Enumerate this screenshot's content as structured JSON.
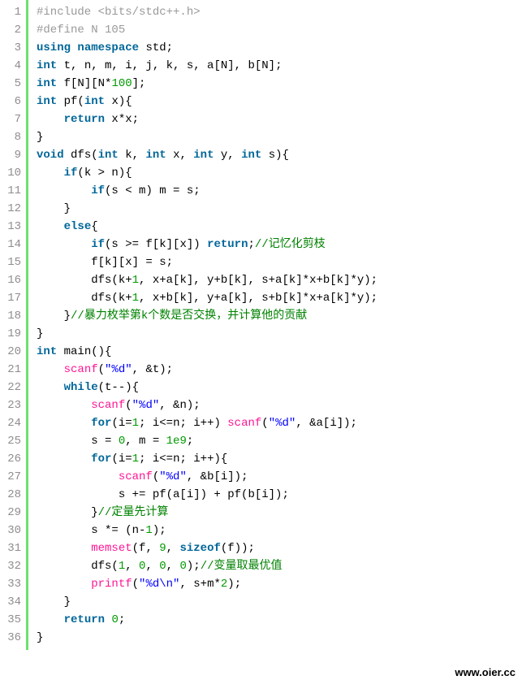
{
  "watermark": "www.oier.cc",
  "lines": [
    [
      {
        "cls": "c-pre",
        "t": "#include <bits/stdc++.h>"
      }
    ],
    [
      {
        "cls": "c-pre",
        "t": "#define N 105"
      }
    ],
    [
      {
        "cls": "c-kw",
        "t": "using"
      },
      {
        "cls": "c-plain",
        "t": " "
      },
      {
        "cls": "c-kw",
        "t": "namespace"
      },
      {
        "cls": "c-plain",
        "t": " std;"
      }
    ],
    [
      {
        "cls": "c-type",
        "t": "int"
      },
      {
        "cls": "c-plain",
        "t": " t, n, m, i, j, k, s, a[N], b[N];"
      }
    ],
    [
      {
        "cls": "c-type",
        "t": "int"
      },
      {
        "cls": "c-plain",
        "t": " f[N][N*"
      },
      {
        "cls": "c-num",
        "t": "100"
      },
      {
        "cls": "c-plain",
        "t": "];"
      }
    ],
    [
      {
        "cls": "c-type",
        "t": "int"
      },
      {
        "cls": "c-plain",
        "t": " pf("
      },
      {
        "cls": "c-type",
        "t": "int"
      },
      {
        "cls": "c-plain",
        "t": " x){"
      }
    ],
    [
      {
        "cls": "c-plain",
        "t": "    "
      },
      {
        "cls": "c-kw",
        "t": "return"
      },
      {
        "cls": "c-plain",
        "t": " x*x;"
      }
    ],
    [
      {
        "cls": "c-plain",
        "t": "}"
      }
    ],
    [
      {
        "cls": "c-type",
        "t": "void"
      },
      {
        "cls": "c-plain",
        "t": " dfs("
      },
      {
        "cls": "c-type",
        "t": "int"
      },
      {
        "cls": "c-plain",
        "t": " k, "
      },
      {
        "cls": "c-type",
        "t": "int"
      },
      {
        "cls": "c-plain",
        "t": " x, "
      },
      {
        "cls": "c-type",
        "t": "int"
      },
      {
        "cls": "c-plain",
        "t": " y, "
      },
      {
        "cls": "c-type",
        "t": "int"
      },
      {
        "cls": "c-plain",
        "t": " s){"
      }
    ],
    [
      {
        "cls": "c-plain",
        "t": "    "
      },
      {
        "cls": "c-kw",
        "t": "if"
      },
      {
        "cls": "c-plain",
        "t": "(k > n){"
      }
    ],
    [
      {
        "cls": "c-plain",
        "t": "        "
      },
      {
        "cls": "c-kw",
        "t": "if"
      },
      {
        "cls": "c-plain",
        "t": "(s < m) m = s;"
      }
    ],
    [
      {
        "cls": "c-plain",
        "t": "    }"
      }
    ],
    [
      {
        "cls": "c-plain",
        "t": "    "
      },
      {
        "cls": "c-kw",
        "t": "else"
      },
      {
        "cls": "c-plain",
        "t": "{"
      }
    ],
    [
      {
        "cls": "c-plain",
        "t": "        "
      },
      {
        "cls": "c-kw",
        "t": "if"
      },
      {
        "cls": "c-plain",
        "t": "(s >= f[k][x]) "
      },
      {
        "cls": "c-kw",
        "t": "return"
      },
      {
        "cls": "c-plain",
        "t": ";"
      },
      {
        "cls": "c-cmt",
        "t": "//记忆化剪枝"
      }
    ],
    [
      {
        "cls": "c-plain",
        "t": "        f[k][x] = s;"
      }
    ],
    [
      {
        "cls": "c-plain",
        "t": "        dfs(k+"
      },
      {
        "cls": "c-num",
        "t": "1"
      },
      {
        "cls": "c-plain",
        "t": ", x+a[k], y+b[k], s+a[k]*x+b[k]*y);"
      }
    ],
    [
      {
        "cls": "c-plain",
        "t": "        dfs(k+"
      },
      {
        "cls": "c-num",
        "t": "1"
      },
      {
        "cls": "c-plain",
        "t": ", x+b[k], y+a[k], s+b[k]*x+a[k]*y);"
      }
    ],
    [
      {
        "cls": "c-plain",
        "t": "    }"
      },
      {
        "cls": "c-cmt",
        "t": "//暴力枚举第k个数是否交换，并计算他的贡献"
      }
    ],
    [
      {
        "cls": "c-plain",
        "t": "}"
      }
    ],
    [
      {
        "cls": "c-type",
        "t": "int"
      },
      {
        "cls": "c-plain",
        "t": " main(){"
      }
    ],
    [
      {
        "cls": "c-plain",
        "t": "    "
      },
      {
        "cls": "c-func",
        "t": "scanf"
      },
      {
        "cls": "c-plain",
        "t": "("
      },
      {
        "cls": "c-str",
        "t": "\"%d\""
      },
      {
        "cls": "c-plain",
        "t": ", &t);"
      }
    ],
    [
      {
        "cls": "c-plain",
        "t": "    "
      },
      {
        "cls": "c-kw",
        "t": "while"
      },
      {
        "cls": "c-plain",
        "t": "(t--){"
      }
    ],
    [
      {
        "cls": "c-plain",
        "t": "        "
      },
      {
        "cls": "c-func",
        "t": "scanf"
      },
      {
        "cls": "c-plain",
        "t": "("
      },
      {
        "cls": "c-str",
        "t": "\"%d\""
      },
      {
        "cls": "c-plain",
        "t": ", &n);"
      }
    ],
    [
      {
        "cls": "c-plain",
        "t": "        "
      },
      {
        "cls": "c-kw",
        "t": "for"
      },
      {
        "cls": "c-plain",
        "t": "(i="
      },
      {
        "cls": "c-num",
        "t": "1"
      },
      {
        "cls": "c-plain",
        "t": "; i<=n; i++) "
      },
      {
        "cls": "c-func",
        "t": "scanf"
      },
      {
        "cls": "c-plain",
        "t": "("
      },
      {
        "cls": "c-str",
        "t": "\"%d\""
      },
      {
        "cls": "c-plain",
        "t": ", &a[i]);"
      }
    ],
    [
      {
        "cls": "c-plain",
        "t": "        s = "
      },
      {
        "cls": "c-num",
        "t": "0"
      },
      {
        "cls": "c-plain",
        "t": ", m = "
      },
      {
        "cls": "c-num",
        "t": "1e9"
      },
      {
        "cls": "c-plain",
        "t": ";"
      }
    ],
    [
      {
        "cls": "c-plain",
        "t": "        "
      },
      {
        "cls": "c-kw",
        "t": "for"
      },
      {
        "cls": "c-plain",
        "t": "(i="
      },
      {
        "cls": "c-num",
        "t": "1"
      },
      {
        "cls": "c-plain",
        "t": "; i<=n; i++){"
      }
    ],
    [
      {
        "cls": "c-plain",
        "t": "            "
      },
      {
        "cls": "c-func",
        "t": "scanf"
      },
      {
        "cls": "c-plain",
        "t": "("
      },
      {
        "cls": "c-str",
        "t": "\"%d\""
      },
      {
        "cls": "c-plain",
        "t": ", &b[i]);"
      }
    ],
    [
      {
        "cls": "c-plain",
        "t": "            s += pf(a[i]) + pf(b[i]);"
      }
    ],
    [
      {
        "cls": "c-plain",
        "t": "        }"
      },
      {
        "cls": "c-cmt",
        "t": "//定量先计算"
      }
    ],
    [
      {
        "cls": "c-plain",
        "t": "        s *= (n-"
      },
      {
        "cls": "c-num",
        "t": "1"
      },
      {
        "cls": "c-plain",
        "t": ");"
      }
    ],
    [
      {
        "cls": "c-plain",
        "t": "        "
      },
      {
        "cls": "c-func",
        "t": "memset"
      },
      {
        "cls": "c-plain",
        "t": "(f, "
      },
      {
        "cls": "c-num",
        "t": "9"
      },
      {
        "cls": "c-plain",
        "t": ", "
      },
      {
        "cls": "c-kw",
        "t": "sizeof"
      },
      {
        "cls": "c-plain",
        "t": "(f));"
      }
    ],
    [
      {
        "cls": "c-plain",
        "t": "        dfs("
      },
      {
        "cls": "c-num",
        "t": "1"
      },
      {
        "cls": "c-plain",
        "t": ", "
      },
      {
        "cls": "c-num",
        "t": "0"
      },
      {
        "cls": "c-plain",
        "t": ", "
      },
      {
        "cls": "c-num",
        "t": "0"
      },
      {
        "cls": "c-plain",
        "t": ", "
      },
      {
        "cls": "c-num",
        "t": "0"
      },
      {
        "cls": "c-plain",
        "t": ");"
      },
      {
        "cls": "c-cmt",
        "t": "//变量取最优值"
      }
    ],
    [
      {
        "cls": "c-plain",
        "t": "        "
      },
      {
        "cls": "c-func",
        "t": "printf"
      },
      {
        "cls": "c-plain",
        "t": "("
      },
      {
        "cls": "c-str",
        "t": "\"%d\\n\""
      },
      {
        "cls": "c-plain",
        "t": ", s+m*"
      },
      {
        "cls": "c-num",
        "t": "2"
      },
      {
        "cls": "c-plain",
        "t": ");"
      }
    ],
    [
      {
        "cls": "c-plain",
        "t": "    }"
      }
    ],
    [
      {
        "cls": "c-plain",
        "t": "    "
      },
      {
        "cls": "c-kw",
        "t": "return"
      },
      {
        "cls": "c-plain",
        "t": " "
      },
      {
        "cls": "c-num",
        "t": "0"
      },
      {
        "cls": "c-plain",
        "t": ";"
      }
    ],
    [
      {
        "cls": "c-plain",
        "t": "}"
      }
    ]
  ]
}
